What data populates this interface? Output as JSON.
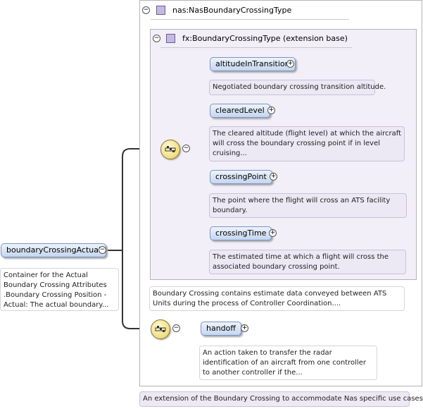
{
  "root": {
    "label": "boundaryCrossingActual",
    "toggle": "−",
    "annotation": "Container for the Actual Boundary Crossing Attributes .Boundary Crossing Position - Actual: The actual boundary..."
  },
  "outer_type": {
    "toggle": "−",
    "label": "nas:NasBoundaryCrossingType",
    "annotation": "An extension of the Boundary Crossing to accommodate Nas specific use cases."
  },
  "base_type": {
    "toggle": "−",
    "label": "fx:BoundaryCrossingType (extension base)",
    "annotation": "Boundary Crossing contains estimate data conveyed between ATS Units during the process of Controller Coordination....",
    "sequence_toggle": "−",
    "elements": [
      {
        "label": "altitudeInTransition",
        "toggle": "+",
        "annotation": "Negotiated boundary crossing transition altitude."
      },
      {
        "label": "clearedLevel",
        "toggle": "+",
        "annotation": "The cleared altitude (flight level) at which the aircraft will cross the boundary crossing point if in level cruising..."
      },
      {
        "label": "crossingPoint",
        "toggle": "+",
        "annotation": "The point where the flight will cross an ATS facility boundary."
      },
      {
        "label": "crossingTime",
        "toggle": "+",
        "annotation": "The estimated time at which a flight will cross the associated boundary crossing point."
      }
    ]
  },
  "ext_sequence": {
    "sequence_toggle": "−",
    "elements": [
      {
        "label": "handoff",
        "toggle": "+",
        "annotation": "An action taken to transfer the radar identification of an aircraft from one controller to another controller if the..."
      }
    ]
  },
  "colors": {
    "element_fill": "#c4d6ef",
    "type_box_fill": "#f2eff8",
    "sequence_fill": "#f0dd80",
    "connector": "#333333"
  }
}
